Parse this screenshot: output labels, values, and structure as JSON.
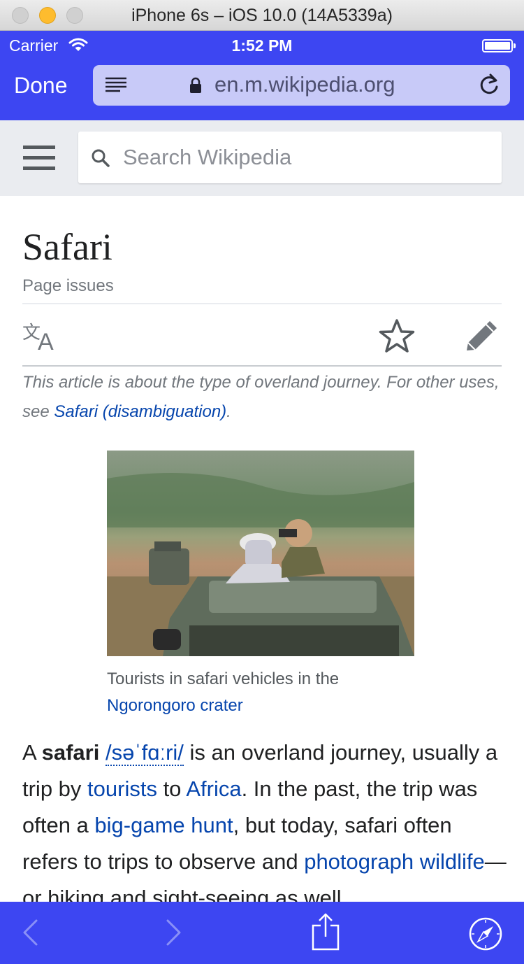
{
  "window": {
    "title": "iPhone 6s – iOS 10.0 (14A5339a)"
  },
  "status_bar": {
    "carrier": "Carrier",
    "time": "1:52 PM"
  },
  "browser": {
    "done_label": "Done",
    "url": "en.m.wikipedia.org"
  },
  "wiki": {
    "search_placeholder": "Search Wikipedia"
  },
  "article": {
    "title": "Safari",
    "page_issues": "Page issues",
    "hatnote_prefix": "This article is about the type of overland journey. For other uses, see ",
    "hatnote_link": "Safari (disambiguation)",
    "hatnote_suffix": ".",
    "image_caption_text": "Tourists in safari vehicles in the ",
    "image_caption_link": "Ngorongoro crater",
    "body": {
      "t1": "A ",
      "bold": "safari",
      "t2": " ",
      "ipa": "/səˈfɑːri/",
      "t3": " is an overland journey, usually a trip by ",
      "link_tourists": "tourists",
      "t4": " to ",
      "link_africa": "Africa",
      "t5": ". In the past, the trip was often a ",
      "link_biggame": "big-game hunt",
      "t6": ", but today, safari often refers to trips to observe and ",
      "link_photograph": "photograph",
      "t7": " ",
      "link_wildlife": "wildlife",
      "t8": "—or hiking and sight-seeing as well."
    }
  },
  "icons": {
    "reader": "reader-icon",
    "lock": "lock-icon",
    "reload": "reload-icon",
    "menu": "hamburger-icon",
    "search": "search-icon",
    "translate": "translate-icon",
    "watch": "star-icon",
    "edit": "pencil-icon",
    "back": "chevron-left-icon",
    "forward": "chevron-right-icon",
    "share": "share-icon",
    "bookmarks": "compass-icon"
  },
  "colors": {
    "browser_chrome": "#3d46f2",
    "url_field": "#c8caf8",
    "link": "#0645ad",
    "wiki_header": "#eaecf0"
  }
}
